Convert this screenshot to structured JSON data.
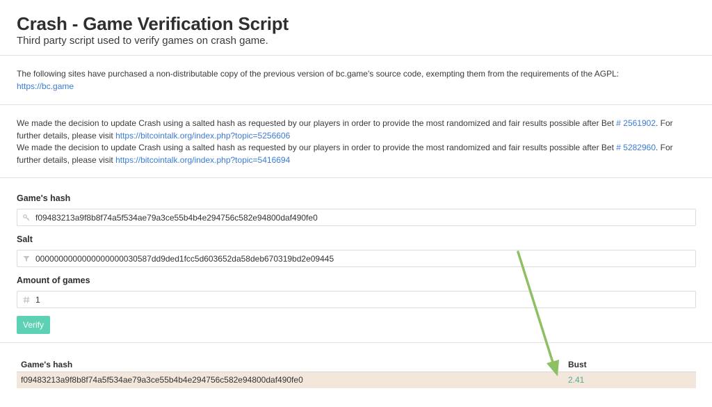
{
  "header": {
    "title": "Crash - Game Verification Script",
    "subtitle": "Third party script used to verify games on crash game."
  },
  "notice": {
    "text": "The following sites have purchased a non-distributable copy of the previous version of bc.game's source code, exempting them from the requirements of the AGPL:",
    "link": "https://bc.game"
  },
  "updates": [
    {
      "text_before": "We made the decision to update Crash using a salted hash as requested by our players in order to provide the most randomized and fair results possible after Bet ",
      "bet_link": "# 2561902",
      "text_after": ". For further details, please visit ",
      "url": "https://bitcointalk.org/index.php?topic=5256606"
    },
    {
      "text_before": "We made the decision to update Crash using a salted hash as requested by our players in order to provide the most randomized and fair results possible after Bet ",
      "bet_link": "# 5282960",
      "text_after": ". For further details, please visit ",
      "url": "https://bitcointalk.org/index.php?topic=5416694"
    }
  ],
  "form": {
    "hash_label": "Game's hash",
    "hash_value": "f09483213a9f8b8f74a5f534ae79a3ce55b4b4e294756c582e94800daf490fe0",
    "salt_label": "Salt",
    "salt_value": "0000000000000000000030587dd9ded1fcc5d603652da58deb670319bd2e09445",
    "amount_label": "Amount of games",
    "amount_value": "1",
    "verify_label": "Verify"
  },
  "results": {
    "columns": [
      "Game's hash",
      "Bust"
    ],
    "rows": [
      {
        "hash": "f09483213a9f8b8f74a5f534ae79a3ce55b4b4e294756c582e94800daf490fe0",
        "bust": "2.41"
      }
    ]
  },
  "icons": {
    "hash_field": "key-icon",
    "salt_field": "filter-icon",
    "amount_field": "hash-icon"
  },
  "colors": {
    "accent_button": "#5dd1b4",
    "link": "#3a7bd5",
    "row_highlight": "#f3e6db",
    "bust_text": "#5aab8e",
    "annotation_arrow": "#8cc063"
  }
}
